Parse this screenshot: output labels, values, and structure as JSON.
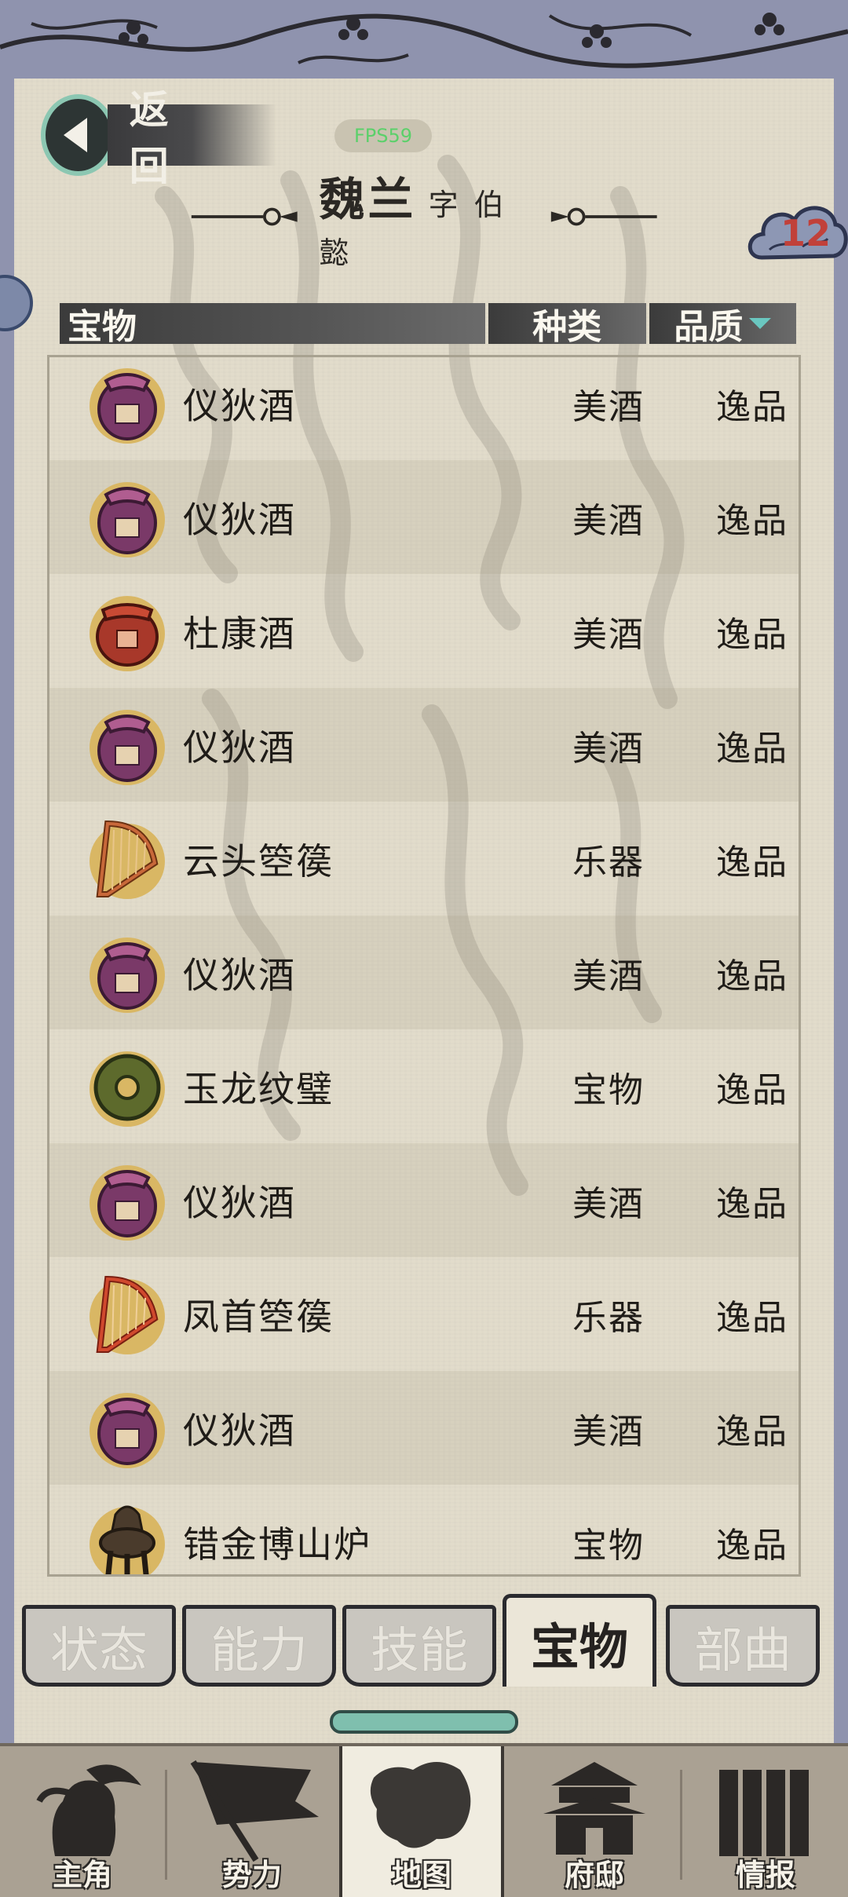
{
  "header": {
    "back_label": "返回",
    "fps_label": "FPS59",
    "character_name": "魏兰",
    "character_style": "字 伯懿",
    "badge_count": "12"
  },
  "table": {
    "col_item": "宝物",
    "col_type": "种类",
    "col_quality": "品质",
    "rows": [
      {
        "name": "仪狄酒",
        "type": "美酒",
        "quality": "逸品",
        "icon": "purple-wine-jar-icon"
      },
      {
        "name": "仪狄酒",
        "type": "美酒",
        "quality": "逸品",
        "icon": "purple-wine-jar-icon"
      },
      {
        "name": "杜康酒",
        "type": "美酒",
        "quality": "逸品",
        "icon": "red-wine-jar-icon"
      },
      {
        "name": "仪狄酒",
        "type": "美酒",
        "quality": "逸品",
        "icon": "purple-wine-jar-icon"
      },
      {
        "name": "云头箜篌",
        "type": "乐器",
        "quality": "逸品",
        "icon": "harp-icon"
      },
      {
        "name": "仪狄酒",
        "type": "美酒",
        "quality": "逸品",
        "icon": "purple-wine-jar-icon"
      },
      {
        "name": "玉龙纹璧",
        "type": "宝物",
        "quality": "逸品",
        "icon": "jade-disc-icon"
      },
      {
        "name": "仪狄酒",
        "type": "美酒",
        "quality": "逸品",
        "icon": "purple-wine-jar-icon"
      },
      {
        "name": "凤首箜篌",
        "type": "乐器",
        "quality": "逸品",
        "icon": "harp-icon"
      },
      {
        "name": "仪狄酒",
        "type": "美酒",
        "quality": "逸品",
        "icon": "purple-wine-jar-icon"
      },
      {
        "name": "错金博山炉",
        "type": "宝物",
        "quality": "逸品",
        "icon": "incense-burner-icon"
      }
    ]
  },
  "tabs": [
    {
      "label": "状态",
      "active": false
    },
    {
      "label": "能力",
      "active": false
    },
    {
      "label": "技能",
      "active": false
    },
    {
      "label": "宝物",
      "active": true
    },
    {
      "label": "部曲",
      "active": false
    }
  ],
  "nav": [
    {
      "label": "主角",
      "icon": "warrior-head-icon",
      "active": false
    },
    {
      "label": "势力",
      "icon": "banner-flag-icon",
      "active": false
    },
    {
      "label": "地图",
      "icon": "map-icon",
      "active": true
    },
    {
      "label": "府邸",
      "icon": "mansion-icon",
      "active": false
    },
    {
      "label": "情报",
      "icon": "scroll-icon",
      "active": false
    }
  ],
  "colors": {
    "parchment": "#e2dccb",
    "frame": "#8f93ae",
    "quality_text": "#1f1c18",
    "badge_text": "#c1413a",
    "fps_green": "#5bd06a"
  }
}
